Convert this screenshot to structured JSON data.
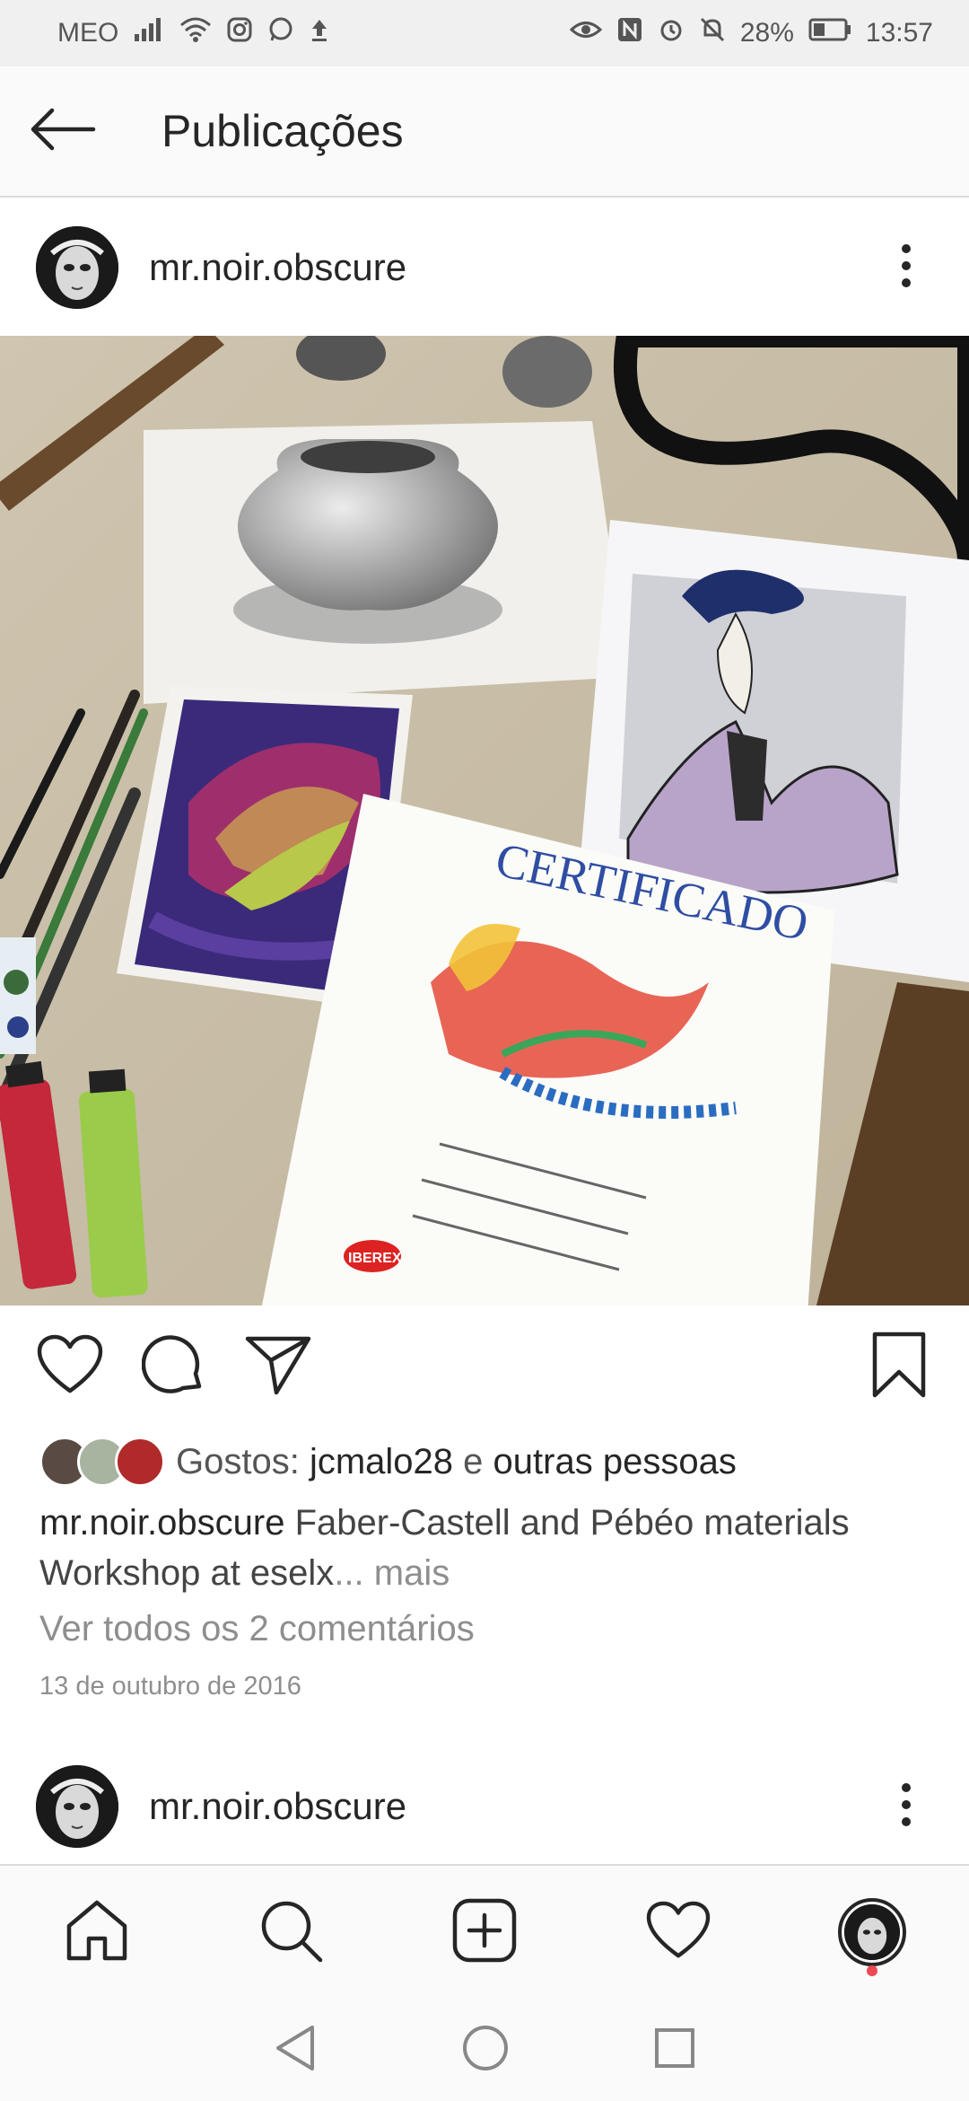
{
  "status_bar": {
    "carrier": "MEO",
    "battery": "28%",
    "time": "13:57"
  },
  "header": {
    "title": "Publicações",
    "back_icon": "arrow-left-icon"
  },
  "post": {
    "username": "mr.noir.obscure",
    "photo_description_icon": "post-photo",
    "likes_prefix": "Gostos:",
    "liker": "jcmalo28",
    "likes_conj": "e",
    "likes_others": "outras pessoas",
    "caption_user": "mr.noir.obscure",
    "caption_text": "Faber-Castell and Pébéo materials Workshop at eselx",
    "caption_more": "... mais",
    "comments_link": "Ver todos os 2 comentários",
    "date": "13 de outubro de 2016"
  },
  "next_post": {
    "username": "mr.noir.obscure"
  },
  "photo_text": {
    "certificate_title": "CERTIFICADO",
    "iberex": "IBEREX"
  },
  "colors": {
    "notification_dot": "#ed4956",
    "muted_text": "#8e8e8e",
    "primary_text": "#262626"
  }
}
